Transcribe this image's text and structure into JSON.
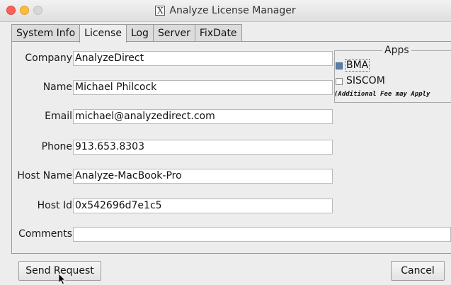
{
  "window": {
    "title": "Analyze License Manager",
    "app_icon": "x11-icon",
    "controls": [
      "close",
      "minimize",
      "maximize"
    ]
  },
  "tabs": [
    {
      "label": "System Info",
      "active": false
    },
    {
      "label": "License",
      "active": true
    },
    {
      "label": "Log",
      "active": false
    },
    {
      "label": "Server",
      "active": false
    },
    {
      "label": "FixDate",
      "active": false
    }
  ],
  "form": {
    "company": {
      "label": "Company",
      "value": "AnalyzeDirect"
    },
    "name": {
      "label": "Name",
      "value": "Michael Philcock"
    },
    "email": {
      "label": "Email",
      "value": "michael@analyzedirect.com"
    },
    "phone": {
      "label": "Phone",
      "value": "913.653.8303"
    },
    "host_name": {
      "label": "Host Name",
      "value": "Analyze-MacBook-Pro"
    },
    "host_id": {
      "label": "Host Id",
      "value": "0x542696d7e1c5"
    },
    "comments": {
      "label": "Comments",
      "value": ""
    }
  },
  "apps": {
    "title": "Apps",
    "items": [
      {
        "label": "BMA",
        "checked": true
      },
      {
        "label": "SISCOM",
        "checked": false
      }
    ],
    "note": "(Additional Fee may Apply"
  },
  "buttons": {
    "send_request": "Send Request",
    "cancel": "Cancel"
  }
}
